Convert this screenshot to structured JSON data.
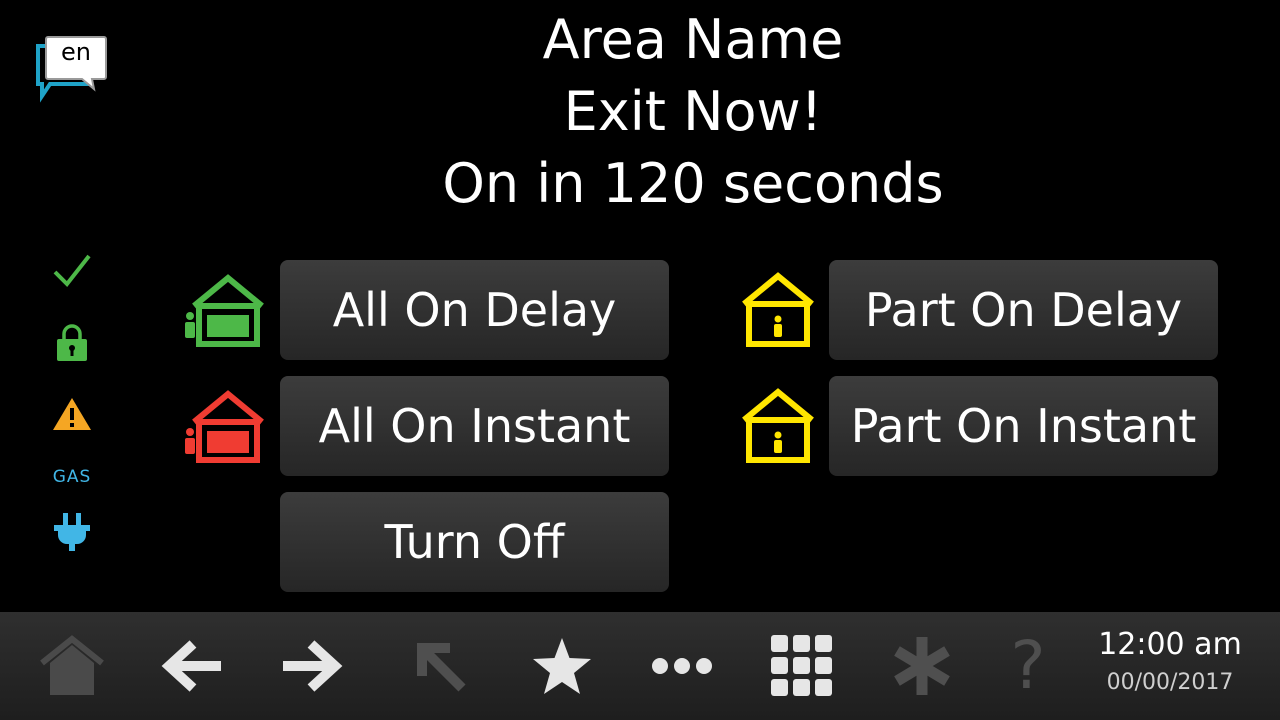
{
  "language": {
    "code": "en"
  },
  "header": {
    "area_name": "Area Name",
    "message": "Exit Now!",
    "countdown": "On in 120 seconds"
  },
  "status_icons": [
    {
      "name": "ready-check-icon",
      "color": "#4db848"
    },
    {
      "name": "lock-icon",
      "color": "#4db848"
    },
    {
      "name": "warning-icon",
      "color": "#f5a623"
    },
    {
      "name": "gas-label",
      "label": "GAS",
      "color": "#41b6e6"
    },
    {
      "name": "power-plug-icon",
      "color": "#41b6e6"
    }
  ],
  "arm_buttons": {
    "all_on_delay": {
      "label": "All On Delay",
      "icon": "all-on-delay-house-icon",
      "color": "#4db848"
    },
    "all_on_instant": {
      "label": "All On Instant",
      "icon": "all-on-instant-house-icon",
      "color": "#f03c32"
    },
    "turn_off": {
      "label": "Turn Off"
    },
    "part_on_delay": {
      "label": "Part On Delay",
      "icon": "part-on-delay-house-icon",
      "color": "#ffe600"
    },
    "part_on_instant": {
      "label": "Part On Instant",
      "icon": "part-on-instant-house-icon",
      "color": "#ffe600"
    }
  },
  "taskbar": {
    "items": [
      "home-icon",
      "back-arrow-icon",
      "forward-arrow-icon",
      "jump-arrow-icon",
      "star-icon",
      "more-icon",
      "keypad-icon",
      "asterisk-icon",
      "help-icon"
    ],
    "time": "12:00 am",
    "date": "00/00/2017"
  }
}
